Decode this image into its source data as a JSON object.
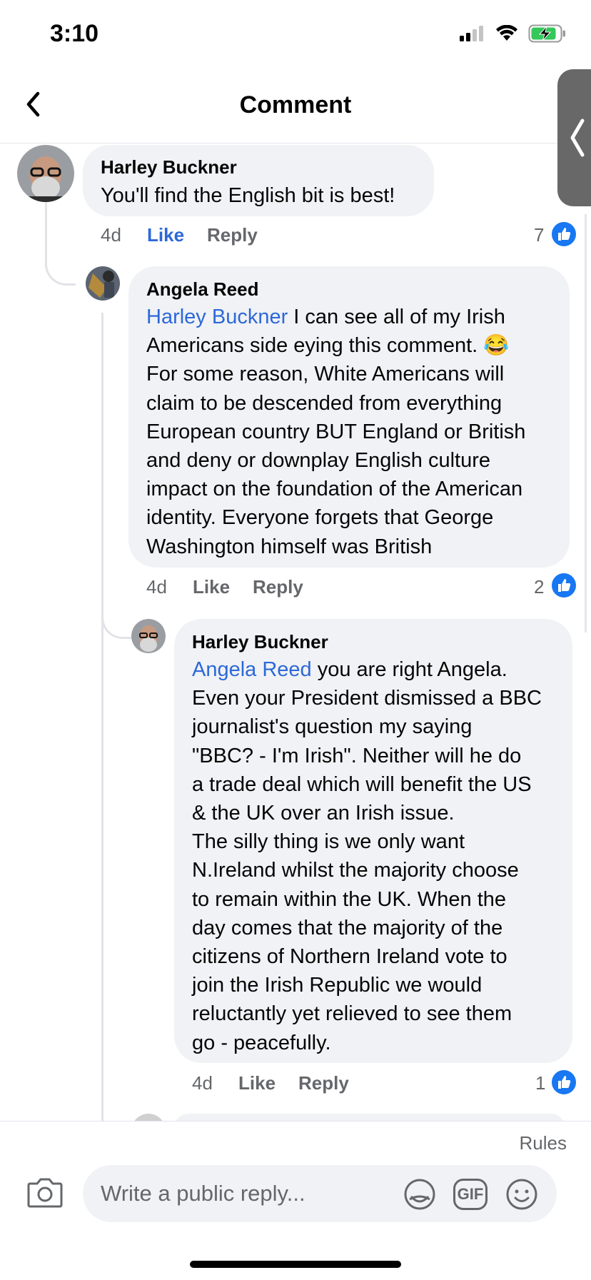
{
  "status": {
    "time": "3:10"
  },
  "header": {
    "title": "Comment"
  },
  "comments": [
    {
      "author": "Harley Buckner",
      "text": "You'll find the English bit is best!",
      "time": "4d",
      "like_label": "Like",
      "reply_label": "Reply",
      "reactions": "7"
    },
    {
      "author": "Angela Reed",
      "mention": "Harley Buckner",
      "lines": [
        " I can see all of my Irish",
        "Americans side eying this comment. 😂",
        "For some reason, White Americans will",
        "claim to be descended from everything",
        "European country BUT England or British",
        "and deny or downplay English culture",
        "impact on the foundation of the American",
        "identity. Everyone forgets that George",
        "Washington himself was British"
      ],
      "time": "4d",
      "like_label": "Like",
      "reply_label": "Reply",
      "reactions": "2"
    },
    {
      "author": "Harley Buckner",
      "mention": "Angela Reed",
      "lines": [
        " you are right Angela.",
        "Even your President dismissed a BBC",
        "journalist's question my saying",
        "\"BBC? - I'm Irish\". Neither will he do",
        "a trade deal which will benefit the US",
        "& the UK over an Irish issue.",
        "The silly thing is we only want",
        "N.Ireland whilst the majority choose",
        "to remain within the UK. When the",
        "day comes that the majority of the",
        "citizens of Northern Ireland vote to",
        "join the Irish Republic we would",
        "reluctantly yet relieved to see them",
        "go - peacefully."
      ],
      "time": "4d",
      "like_label": "Like",
      "reply_label": "Reply",
      "reactions": "1"
    }
  ],
  "composer": {
    "rules_label": "Rules",
    "placeholder": "Write a public reply...",
    "gif_label": "GIF"
  },
  "colors": {
    "mention": "#2d68d8",
    "like_blue": "#1877f2",
    "bubble": "#f0f2f5"
  }
}
